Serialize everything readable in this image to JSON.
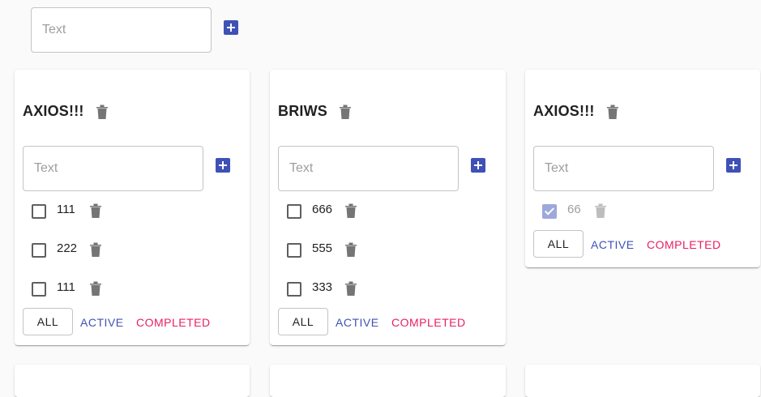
{
  "new_list": {
    "input_value": "",
    "input_placeholder": "Text",
    "add_icon": "plus-square-icon"
  },
  "colors": {
    "primary": "#3f51b5",
    "secondary": "#e91e63",
    "icon_grey": "#757575",
    "checked": "#9fa8da"
  },
  "lists": [
    {
      "title": "AXIOS!!!",
      "input_placeholder": "Text",
      "tasks": [
        {
          "text": "111",
          "done": false
        },
        {
          "text": "222",
          "done": false
        },
        {
          "text": "111",
          "done": false
        }
      ],
      "filters": {
        "all": "ALL",
        "active": "ACTIVE",
        "completed": "COMPLETED"
      }
    },
    {
      "title": "BRIWS",
      "input_placeholder": "Text",
      "tasks": [
        {
          "text": "666",
          "done": false
        },
        {
          "text": "555",
          "done": false
        },
        {
          "text": "333",
          "done": false
        }
      ],
      "filters": {
        "all": "ALL",
        "active": "ACTIVE",
        "completed": "COMPLETED"
      }
    },
    {
      "title": "AXIOS!!!",
      "input_placeholder": "Text",
      "tasks": [
        {
          "text": "66",
          "done": true
        }
      ],
      "filters": {
        "all": "ALL",
        "active": "ACTIVE",
        "completed": "COMPLETED"
      }
    }
  ]
}
